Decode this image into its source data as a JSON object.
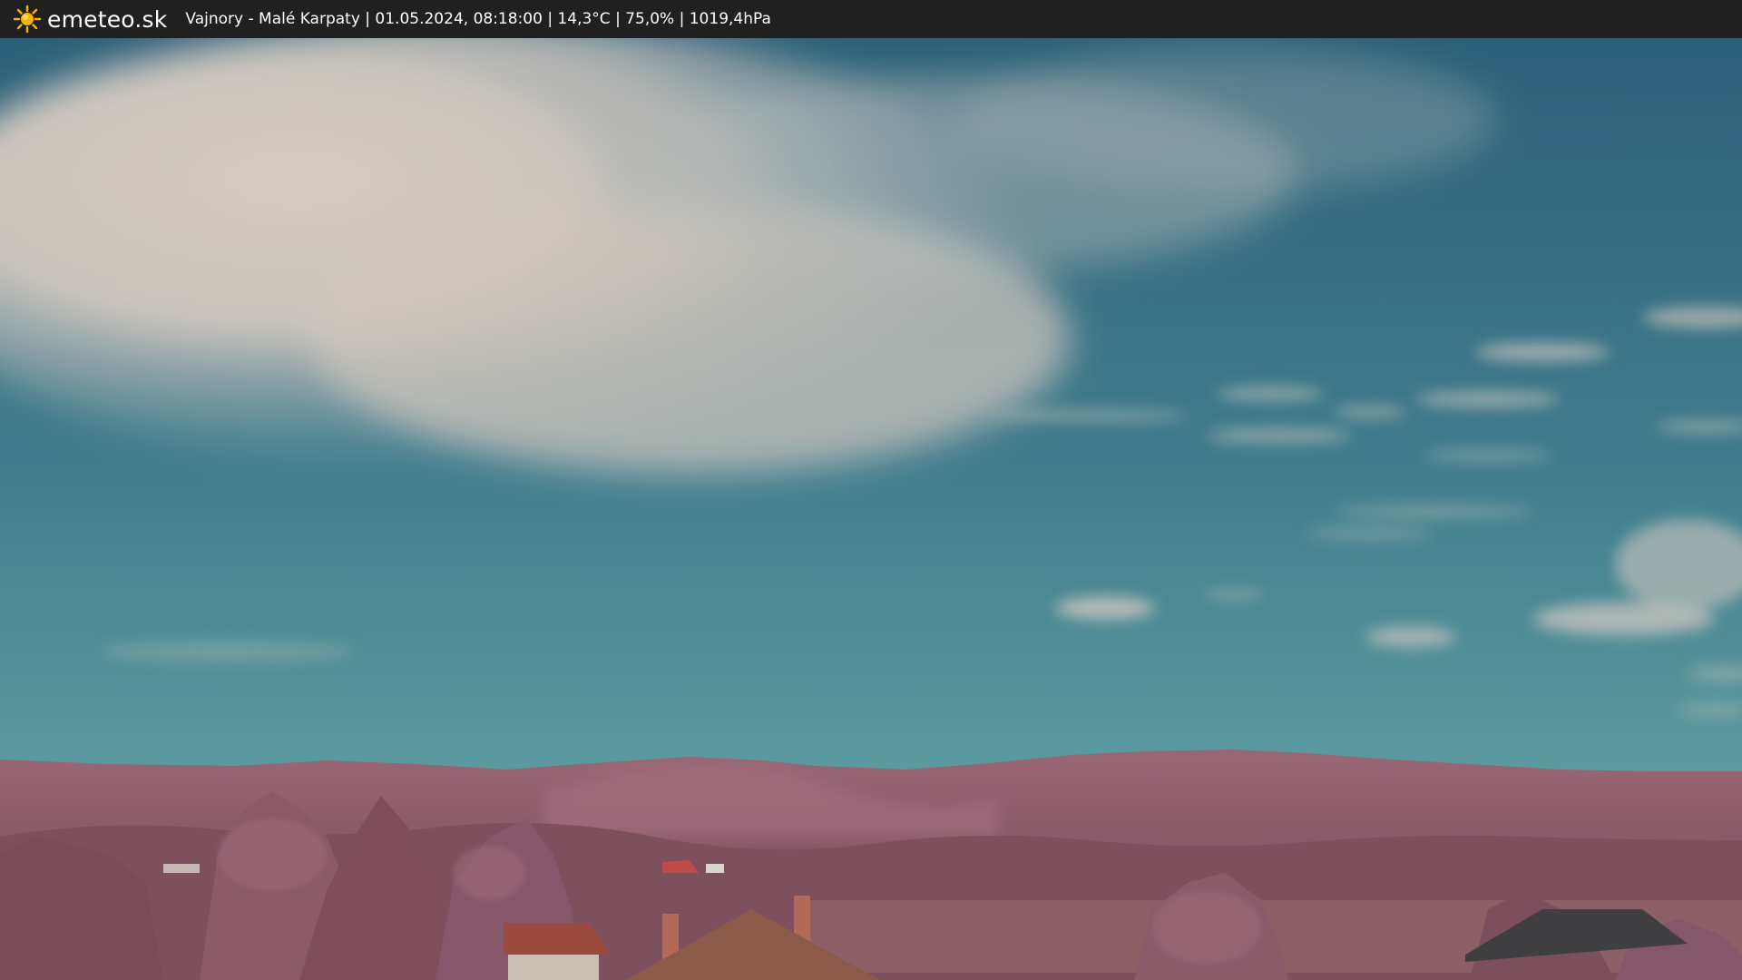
{
  "header": {
    "brand": "emeteo.sk",
    "logo_icon": "sun-icon",
    "info_text": "Vajnory - Malé Karpaty | 01.05.2024, 08:18:00 | 14,3°C | 75,0% | 1019,4hPa"
  },
  "webcam": {
    "content": "webcam-image"
  },
  "colors": {
    "bar_background": "#202020",
    "sun": "#f5b400",
    "sky_top": "#2f6e82",
    "sky_bottom": "#5c9aa0",
    "cloud": "#cfc6bd",
    "hills": "#8a5a68",
    "trees": "#8e5e6c"
  }
}
